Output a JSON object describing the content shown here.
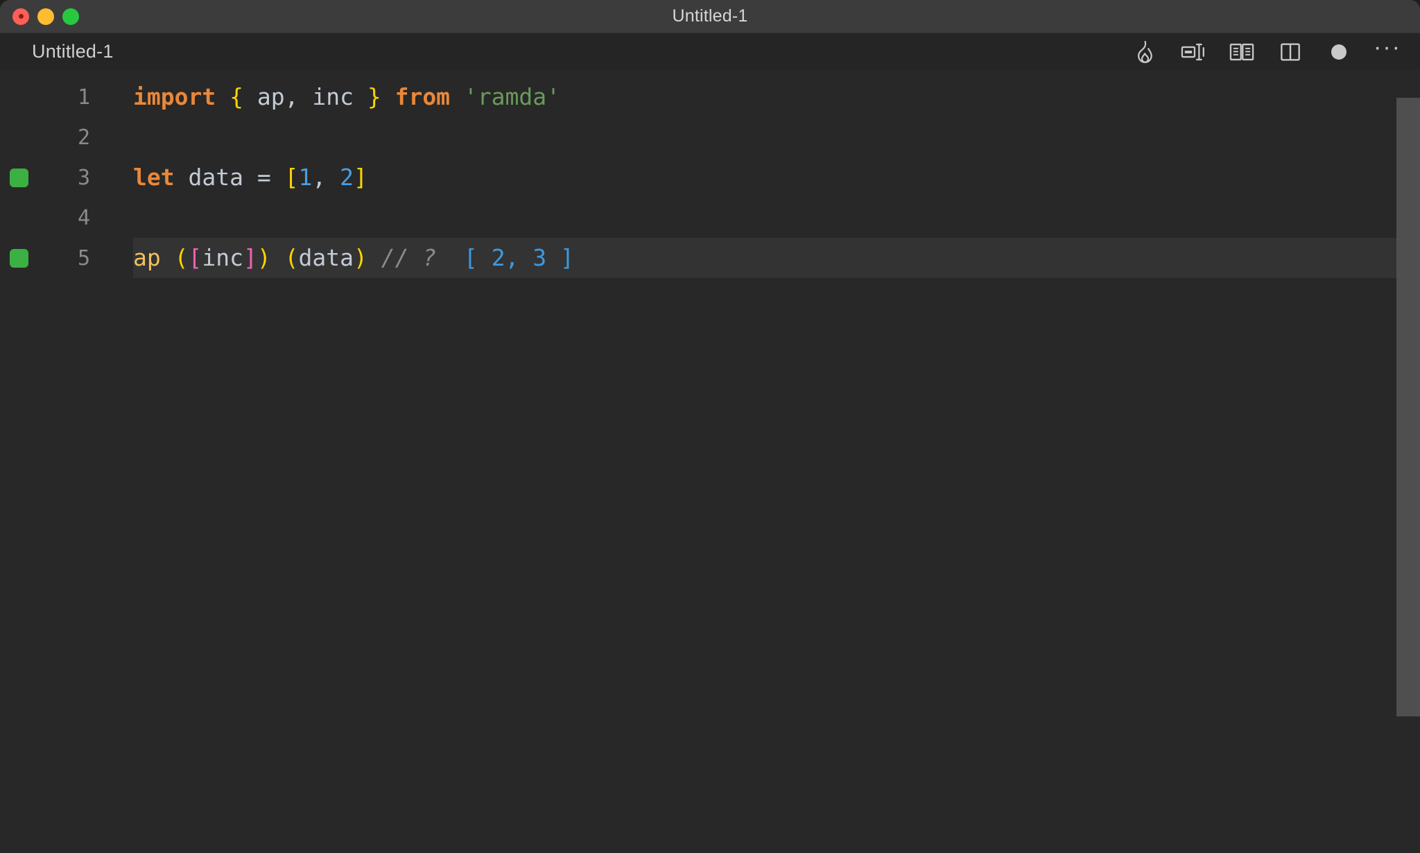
{
  "window": {
    "title": "Untitled-1",
    "traffic_lights": [
      {
        "name": "close",
        "color": "#ff5f57"
      },
      {
        "name": "minimize",
        "color": "#febc2e"
      },
      {
        "name": "maximize",
        "color": "#28c840"
      }
    ]
  },
  "editor_header": {
    "tab_label": "Untitled-1",
    "actions": [
      {
        "name": "flame-icon",
        "label": "Run / Quokka"
      },
      {
        "name": "inline-values-icon",
        "label": "Toggle inline values"
      },
      {
        "name": "book-icon",
        "label": "Open documentation"
      },
      {
        "name": "split-editor-icon",
        "label": "Split editor"
      },
      {
        "name": "unsaved-dot-icon",
        "label": "Unsaved changes"
      },
      {
        "name": "more-actions-icon",
        "label": "More actions..."
      }
    ],
    "ellipsis": "···"
  },
  "colors": {
    "titlebar_bg": "#3c3c3c",
    "header_bg": "#252526",
    "editor_bg": "#282828",
    "active_line_bg": "#333333",
    "gutter_marker_green": "#3cb043",
    "keyword_orange": "#e8883a",
    "brace_yellow": "#ffd400",
    "bracket_magenta": "#f062b4",
    "identifier_gray": "#c3cbd6",
    "string_green": "#6a9a5b",
    "number_blue": "#4a9ee0",
    "function_yellow": "#f3c05a",
    "comment_gray": "#8a8a8a",
    "result_blue": "#3d9ae0",
    "scrollbar": "#4f4f4f"
  },
  "code": {
    "language": "javascript",
    "lines": [
      {
        "number": "1",
        "marker": false,
        "active": false,
        "text": "import { ap, inc } from 'ramda'",
        "tokens": [
          {
            "t": "import",
            "c": "t-keyword"
          },
          {
            "t": " ",
            "c": "t-ident"
          },
          {
            "t": "{",
            "c": "t-brace"
          },
          {
            "t": " ",
            "c": "t-ident"
          },
          {
            "t": "ap",
            "c": "t-ident"
          },
          {
            "t": ",",
            "c": "t-ident"
          },
          {
            "t": " ",
            "c": "t-ident"
          },
          {
            "t": "inc",
            "c": "t-ident"
          },
          {
            "t": " ",
            "c": "t-ident"
          },
          {
            "t": "}",
            "c": "t-brace"
          },
          {
            "t": " ",
            "c": "t-ident"
          },
          {
            "t": "from",
            "c": "t-keyword"
          },
          {
            "t": " ",
            "c": "t-ident"
          },
          {
            "t": "'ramda'",
            "c": "t-string"
          }
        ]
      },
      {
        "number": "2",
        "marker": false,
        "active": false,
        "text": "",
        "tokens": []
      },
      {
        "number": "3",
        "marker": true,
        "active": false,
        "text": "let data = [1, 2]",
        "tokens": [
          {
            "t": "let",
            "c": "t-keyword"
          },
          {
            "t": " ",
            "c": "t-ident"
          },
          {
            "t": "data",
            "c": "t-var"
          },
          {
            "t": " ",
            "c": "t-ident"
          },
          {
            "t": "=",
            "c": "t-operator"
          },
          {
            "t": " ",
            "c": "t-ident"
          },
          {
            "t": "[",
            "c": "t-bracket"
          },
          {
            "t": "1",
            "c": "t-number"
          },
          {
            "t": ",",
            "c": "t-ident"
          },
          {
            "t": " ",
            "c": "t-ident"
          },
          {
            "t": "2",
            "c": "t-number"
          },
          {
            "t": "]",
            "c": "t-bracket"
          }
        ]
      },
      {
        "number": "4",
        "marker": false,
        "active": false,
        "text": "",
        "tokens": []
      },
      {
        "number": "5",
        "marker": true,
        "active": true,
        "text": "ap ([inc]) (data) // ?  [ 2, 3 ]",
        "tokens": [
          {
            "t": "ap",
            "c": "t-func"
          },
          {
            "t": " ",
            "c": "t-ident"
          },
          {
            "t": "(",
            "c": "t-paren"
          },
          {
            "t": "[",
            "c": "t-magenta"
          },
          {
            "t": "inc",
            "c": "t-ident"
          },
          {
            "t": "]",
            "c": "t-magenta"
          },
          {
            "t": ")",
            "c": "t-paren"
          },
          {
            "t": " ",
            "c": "t-ident"
          },
          {
            "t": "(",
            "c": "t-paren"
          },
          {
            "t": "data",
            "c": "t-var"
          },
          {
            "t": ")",
            "c": "t-paren"
          },
          {
            "t": " ",
            "c": "t-ident"
          },
          {
            "t": "// ?",
            "c": "t-comment"
          },
          {
            "t": "  ",
            "c": "t-ident"
          },
          {
            "t": "[ 2, 3 ]",
            "c": "t-result"
          }
        ]
      }
    ]
  },
  "scrollbar": {
    "orientation": "vertical",
    "visible": true
  }
}
